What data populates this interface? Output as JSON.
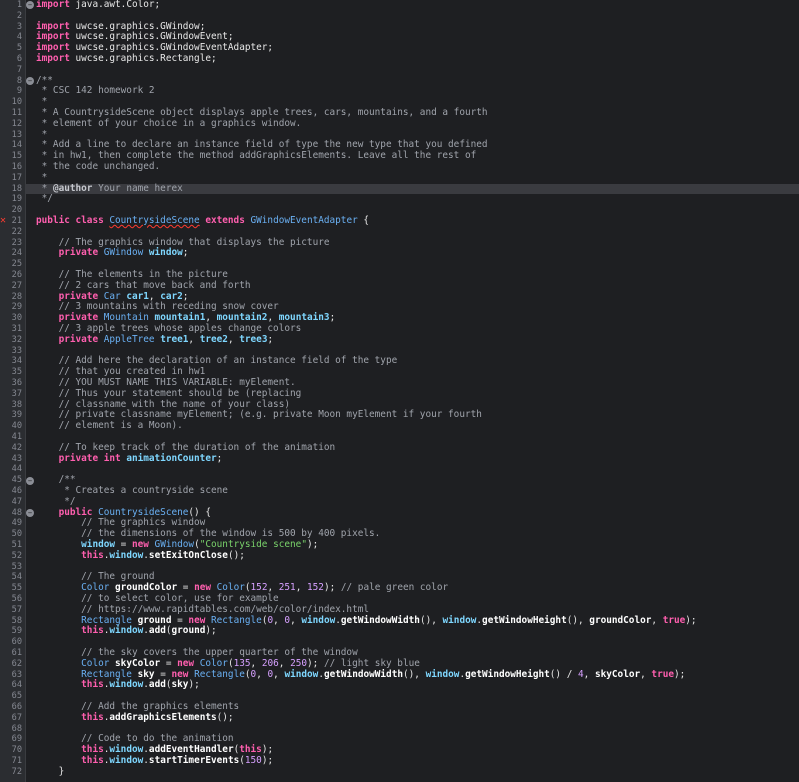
{
  "line_numbers": [
    "1",
    "2",
    "3",
    "4",
    "5",
    "6",
    "7",
    "8",
    "9",
    "10",
    "11",
    "12",
    "13",
    "14",
    "15",
    "16",
    "17",
    "18",
    "19",
    "20",
    "21",
    "22",
    "23",
    "24",
    "25",
    "26",
    "27",
    "28",
    "29",
    "30",
    "31",
    "32",
    "33",
    "34",
    "35",
    "36",
    "37",
    "38",
    "39",
    "40",
    "41",
    "42",
    "43",
    "44",
    "45",
    "46",
    "47",
    "48",
    "49",
    "50",
    "51",
    "52",
    "53",
    "54",
    "55",
    "56",
    "57",
    "58",
    "59",
    "60",
    "61",
    "62",
    "63",
    "64",
    "65",
    "66",
    "67",
    "68",
    "69",
    "70",
    "71",
    "72"
  ],
  "highlighted_line": 18,
  "error_line": 21,
  "fold_marker_lines": [
    1,
    8,
    45,
    48
  ],
  "colors": {
    "background": "#1e1f22",
    "keyword": "#ff5faf",
    "type": "#6ab0f3",
    "field": "#7fd7ff",
    "comment": "#a0a4ac",
    "string": "#7ad36b",
    "number": "#d6a0ff",
    "error": "#ff3b30"
  },
  "lines": [
    [
      [
        "kw",
        "import"
      ],
      [
        "pl",
        " java.awt.Color;"
      ]
    ],
    [],
    [
      [
        "kw",
        "import"
      ],
      [
        "pl",
        " uwcse.graphics.GWindow;"
      ]
    ],
    [
      [
        "kw",
        "import"
      ],
      [
        "pl",
        " uwcse.graphics.GWindowEvent;"
      ]
    ],
    [
      [
        "kw",
        "import"
      ],
      [
        "pl",
        " uwcse.graphics.GWindowEventAdapter;"
      ]
    ],
    [
      [
        "kw",
        "import"
      ],
      [
        "pl",
        " uwcse.graphics.Rectangle;"
      ]
    ],
    [],
    [
      [
        "cm",
        "/**"
      ]
    ],
    [
      [
        "cm",
        " * CSC 142 homework 2"
      ]
    ],
    [
      [
        "cm",
        " *"
      ]
    ],
    [
      [
        "cm",
        " * A CountrysideScene object displays apple trees, cars, mountains, and a fourth"
      ]
    ],
    [
      [
        "cm",
        " * element of your choice in a graphics window."
      ]
    ],
    [
      [
        "cm",
        " *"
      ]
    ],
    [
      [
        "cm",
        " * Add a line to declare an instance field of type the new type that you defined"
      ]
    ],
    [
      [
        "cm",
        " * in hw1, then complete the method addGraphicsElements. Leave all the rest of"
      ]
    ],
    [
      [
        "cm",
        " * the code unchanged."
      ]
    ],
    [
      [
        "cm",
        " *"
      ]
    ],
    [
      [
        "cm",
        " * "
      ],
      [
        "an",
        "@author"
      ],
      [
        "cm",
        " Your name herex"
      ]
    ],
    [
      [
        "cm",
        " */"
      ]
    ],
    [],
    [
      [
        "kw",
        "public class "
      ],
      [
        "ty err",
        "CountrysideScene"
      ],
      [
        "kw",
        " extends "
      ],
      [
        "ty",
        "GWindowEventAdapter"
      ],
      [
        "pl",
        " {"
      ]
    ],
    [],
    [
      [
        "cm",
        "    // The graphics window that displays the picture"
      ]
    ],
    [
      [
        "kw",
        "    private "
      ],
      [
        "ty",
        "GWindow "
      ],
      [
        "fld",
        "window"
      ],
      [
        "pl",
        ";"
      ]
    ],
    [],
    [
      [
        "cm",
        "    // The elements in the picture"
      ]
    ],
    [
      [
        "cm",
        "    // 2 cars that move back and forth"
      ]
    ],
    [
      [
        "kw",
        "    private "
      ],
      [
        "ty",
        "Car "
      ],
      [
        "fld",
        "car1"
      ],
      [
        "pl",
        ", "
      ],
      [
        "fld",
        "car2"
      ],
      [
        "pl",
        ";"
      ]
    ],
    [
      [
        "cm",
        "    // 3 mountains with receding snow cover"
      ]
    ],
    [
      [
        "kw",
        "    private "
      ],
      [
        "ty",
        "Mountain "
      ],
      [
        "fld",
        "mountain1"
      ],
      [
        "pl",
        ", "
      ],
      [
        "fld",
        "mountain2"
      ],
      [
        "pl",
        ", "
      ],
      [
        "fld",
        "mountain3"
      ],
      [
        "pl",
        ";"
      ]
    ],
    [
      [
        "cm",
        "    // 3 apple trees whose apples change colors"
      ]
    ],
    [
      [
        "kw",
        "    private "
      ],
      [
        "ty",
        "AppleTree "
      ],
      [
        "fld",
        "tree1"
      ],
      [
        "pl",
        ", "
      ],
      [
        "fld",
        "tree2"
      ],
      [
        "pl",
        ", "
      ],
      [
        "fld",
        "tree3"
      ],
      [
        "pl",
        ";"
      ]
    ],
    [],
    [
      [
        "cm",
        "    // Add here the declaration of an instance field of the type"
      ]
    ],
    [
      [
        "cm",
        "    // that you created in hw1"
      ]
    ],
    [
      [
        "cm",
        "    // YOU MUST NAME THIS VARIABLE: myElement."
      ]
    ],
    [
      [
        "cm",
        "    // Thus your statement should be (replacing"
      ]
    ],
    [
      [
        "cm",
        "    // classname with the name of your class)"
      ]
    ],
    [
      [
        "cm",
        "    // private classname myElement; (e.g. private Moon myElement if your fourth"
      ]
    ],
    [
      [
        "cm",
        "    // element is a Moon)."
      ]
    ],
    [],
    [
      [
        "cm",
        "    // To keep track of the duration of the animation"
      ]
    ],
    [
      [
        "kw",
        "    private int "
      ],
      [
        "fld",
        "animationCounter"
      ],
      [
        "pl",
        ";"
      ]
    ],
    [],
    [
      [
        "cm",
        "    /**"
      ]
    ],
    [
      [
        "cm",
        "     * Creates a countryside scene"
      ]
    ],
    [
      [
        "cm",
        "     */"
      ]
    ],
    [
      [
        "kw",
        "    public "
      ],
      [
        "ty",
        "CountrysideScene"
      ],
      [
        "pl",
        "() {"
      ]
    ],
    [
      [
        "cm",
        "        // The graphics window"
      ]
    ],
    [
      [
        "cm",
        "        // the dimensions of the window is 500 by 400 pixels."
      ]
    ],
    [
      [
        "fld",
        "        window"
      ],
      [
        "pl",
        " = "
      ],
      [
        "kw",
        "new "
      ],
      [
        "ty",
        "GWindow"
      ],
      [
        "pl",
        "("
      ],
      [
        "st",
        "\"Countryside scene\""
      ],
      [
        "pl",
        ");"
      ]
    ],
    [
      [
        "kw",
        "        this"
      ],
      [
        "pl",
        "."
      ],
      [
        "fld",
        "window"
      ],
      [
        "pl",
        "."
      ],
      [
        "me",
        "setExitOnClose"
      ],
      [
        "pl",
        "();"
      ]
    ],
    [],
    [
      [
        "cm",
        "        // The ground"
      ]
    ],
    [
      [
        "ty",
        "        Color "
      ],
      [
        "me",
        "groundColor"
      ],
      [
        "pl",
        " = "
      ],
      [
        "kw",
        "new "
      ],
      [
        "ty",
        "Color"
      ],
      [
        "pl",
        "("
      ],
      [
        "nm",
        "152"
      ],
      [
        "pl",
        ", "
      ],
      [
        "nm",
        "251"
      ],
      [
        "pl",
        ", "
      ],
      [
        "nm",
        "152"
      ],
      [
        "pl",
        "); "
      ],
      [
        "cm",
        "// pale green color"
      ]
    ],
    [
      [
        "cm",
        "        // to select color, use for example"
      ]
    ],
    [
      [
        "cm",
        "        // https://www.rapidtables.com/web/color/index.html"
      ]
    ],
    [
      [
        "ty",
        "        Rectangle "
      ],
      [
        "me",
        "ground"
      ],
      [
        "pl",
        " = "
      ],
      [
        "kw",
        "new "
      ],
      [
        "ty",
        "Rectangle"
      ],
      [
        "pl",
        "("
      ],
      [
        "nm",
        "0"
      ],
      [
        "pl",
        ", "
      ],
      [
        "nm",
        "0"
      ],
      [
        "pl",
        ", "
      ],
      [
        "fld",
        "window"
      ],
      [
        "pl",
        "."
      ],
      [
        "me",
        "getWindowWidth"
      ],
      [
        "pl",
        "(), "
      ],
      [
        "fld",
        "window"
      ],
      [
        "pl",
        "."
      ],
      [
        "me",
        "getWindowHeight"
      ],
      [
        "pl",
        "(), "
      ],
      [
        "me",
        "groundColor"
      ],
      [
        "pl",
        ", "
      ],
      [
        "kw",
        "true"
      ],
      [
        "pl",
        ");"
      ]
    ],
    [
      [
        "kw",
        "        this"
      ],
      [
        "pl",
        "."
      ],
      [
        "fld",
        "window"
      ],
      [
        "pl",
        "."
      ],
      [
        "me",
        "add"
      ],
      [
        "pl",
        "("
      ],
      [
        "me",
        "ground"
      ],
      [
        "pl",
        ");"
      ]
    ],
    [],
    [
      [
        "cm",
        "        // the sky covers the upper quarter of the window"
      ]
    ],
    [
      [
        "ty",
        "        Color "
      ],
      [
        "me",
        "skyColor"
      ],
      [
        "pl",
        " = "
      ],
      [
        "kw",
        "new "
      ],
      [
        "ty",
        "Color"
      ],
      [
        "pl",
        "("
      ],
      [
        "nm",
        "135"
      ],
      [
        "pl",
        ", "
      ],
      [
        "nm",
        "206"
      ],
      [
        "pl",
        ", "
      ],
      [
        "nm",
        "250"
      ],
      [
        "pl",
        "); "
      ],
      [
        "cm",
        "// light sky blue"
      ]
    ],
    [
      [
        "ty",
        "        Rectangle "
      ],
      [
        "me",
        "sky"
      ],
      [
        "pl",
        " = "
      ],
      [
        "kw",
        "new "
      ],
      [
        "ty",
        "Rectangle"
      ],
      [
        "pl",
        "("
      ],
      [
        "nm",
        "0"
      ],
      [
        "pl",
        ", "
      ],
      [
        "nm",
        "0"
      ],
      [
        "pl",
        ", "
      ],
      [
        "fld",
        "window"
      ],
      [
        "pl",
        "."
      ],
      [
        "me",
        "getWindowWidth"
      ],
      [
        "pl",
        "(), "
      ],
      [
        "fld",
        "window"
      ],
      [
        "pl",
        "."
      ],
      [
        "me",
        "getWindowHeight"
      ],
      [
        "pl",
        "() / "
      ],
      [
        "nm",
        "4"
      ],
      [
        "pl",
        ", "
      ],
      [
        "me",
        "skyColor"
      ],
      [
        "pl",
        ", "
      ],
      [
        "kw",
        "true"
      ],
      [
        "pl",
        ");"
      ]
    ],
    [
      [
        "kw",
        "        this"
      ],
      [
        "pl",
        "."
      ],
      [
        "fld",
        "window"
      ],
      [
        "pl",
        "."
      ],
      [
        "me",
        "add"
      ],
      [
        "pl",
        "("
      ],
      [
        "me",
        "sky"
      ],
      [
        "pl",
        ");"
      ]
    ],
    [],
    [
      [
        "cm",
        "        // Add the graphics elements"
      ]
    ],
    [
      [
        "kw",
        "        this"
      ],
      [
        "pl",
        "."
      ],
      [
        "me",
        "addGraphicsElements"
      ],
      [
        "pl",
        "();"
      ]
    ],
    [],
    [
      [
        "cm",
        "        // Code to do the animation"
      ]
    ],
    [
      [
        "kw",
        "        this"
      ],
      [
        "pl",
        "."
      ],
      [
        "fld",
        "window"
      ],
      [
        "pl",
        "."
      ],
      [
        "me",
        "addEventHandler"
      ],
      [
        "pl",
        "("
      ],
      [
        "kw",
        "this"
      ],
      [
        "pl",
        ");"
      ]
    ],
    [
      [
        "kw",
        "        this"
      ],
      [
        "pl",
        "."
      ],
      [
        "fld",
        "window"
      ],
      [
        "pl",
        "."
      ],
      [
        "me",
        "startTimerEvents"
      ],
      [
        "pl",
        "("
      ],
      [
        "nm",
        "150"
      ],
      [
        "pl",
        ");"
      ]
    ],
    [
      [
        "pl",
        "    }"
      ]
    ]
  ]
}
